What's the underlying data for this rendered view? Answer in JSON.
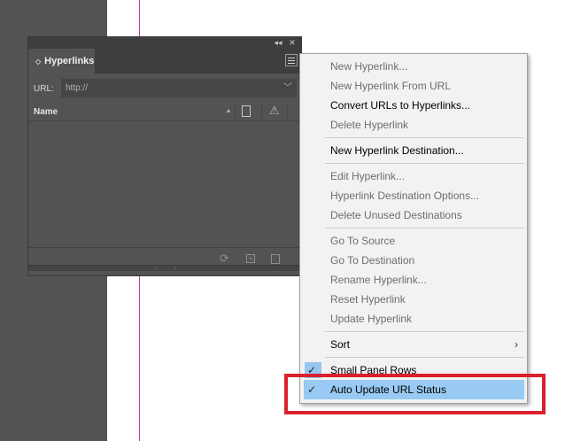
{
  "panel": {
    "tab_label": "Hyperlinks",
    "collapse_glyph": "◂◂",
    "close_glyph": "✕",
    "url_label": "URL:",
    "url_value": "http://",
    "name_column": "Name",
    "sort_glyph": "▴",
    "warning_glyph": "⚠",
    "footer": {
      "refresh_glyph": "⟳",
      "new_glyph": "+"
    }
  },
  "menu": {
    "new_hyperlink": "New Hyperlink...",
    "new_hyperlink_from_url": "New Hyperlink From URL",
    "convert_urls": "Convert URLs to Hyperlinks...",
    "delete_hyperlink": "Delete Hyperlink",
    "new_destination": "New Hyperlink Destination...",
    "edit_hyperlink": "Edit Hyperlink...",
    "destination_options": "Hyperlink Destination Options...",
    "delete_unused": "Delete Unused Destinations",
    "go_to_source": "Go To Source",
    "go_to_destination": "Go To Destination",
    "rename_hyperlink": "Rename Hyperlink...",
    "reset_hyperlink": "Reset Hyperlink",
    "update_hyperlink": "Update Hyperlink",
    "sort": "Sort",
    "small_panel_rows": "Small Panel Rows",
    "auto_update_url_status": "Auto Update URL Status",
    "submenu_glyph": "›",
    "check_glyph": "✓"
  },
  "colors": {
    "highlight": "#98caf3",
    "annotation": "#d9202d",
    "margin_guide": "#b83aa8"
  }
}
